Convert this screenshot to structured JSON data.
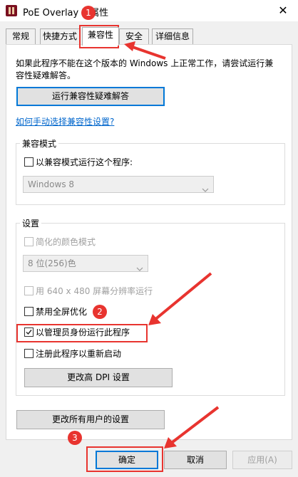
{
  "window": {
    "title": "PoE Overlay II 属性",
    "close_icon": "close-icon"
  },
  "tabs": [
    {
      "label": "常规"
    },
    {
      "label": "快捷方式"
    },
    {
      "label": "兼容性",
      "active": true
    },
    {
      "label": "安全"
    },
    {
      "label": "详细信息"
    }
  ],
  "intro": {
    "line1": "如果此程序不能在这个版本的 Windows 上正常工作，请尝试运行兼",
    "line2": "容性疑难解答。"
  },
  "troubleshoot_button": "运行兼容性疑难解答",
  "manual_link": "如何手动选择兼容性设置?",
  "compat_mode": {
    "title": "兼容模式",
    "checkbox_label": "以兼容模式运行这个程序:",
    "checked": false,
    "select_value": "Windows 8"
  },
  "settings": {
    "title": "设置",
    "reduced_color_label": "简化的颜色模式",
    "color_select_value": "8 位(256)色",
    "res640_label": "用 640 x 480 屏幕分辨率运行",
    "disable_fullscreen_label": "禁用全屏优化",
    "disable_fullscreen_checked": false,
    "run_as_admin_label": "以管理员身份运行此程序",
    "run_as_admin_checked": true,
    "register_restart_label": "注册此程序以重新启动",
    "register_restart_checked": false,
    "dpi_button": "更改高 DPI 设置"
  },
  "all_users_button": "更改所有用户的设置",
  "footer": {
    "ok": "确定",
    "cancel": "取消",
    "apply": "应用(A)"
  },
  "annotations": {
    "badge1": "1",
    "badge2": "2",
    "badge3": "3",
    "color": "#e8342f"
  }
}
